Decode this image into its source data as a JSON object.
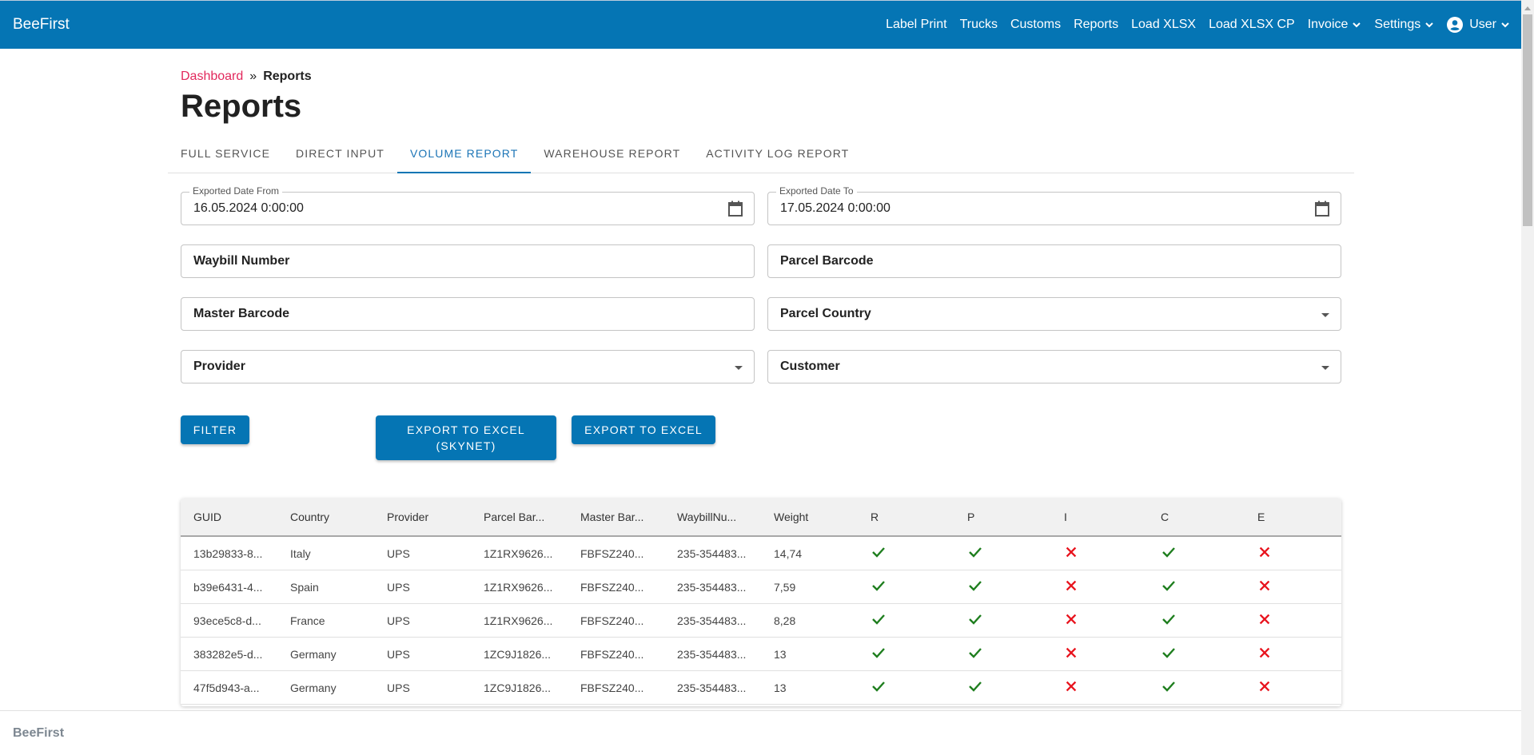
{
  "app": {
    "brand": "BeeFirst",
    "accent_color": "#0575b4"
  },
  "nav": {
    "items": [
      {
        "label": "Label Print",
        "dropdown": false
      },
      {
        "label": "Trucks",
        "dropdown": false
      },
      {
        "label": "Customs",
        "dropdown": false
      },
      {
        "label": "Reports",
        "dropdown": false
      },
      {
        "label": "Load XLSX",
        "dropdown": false
      },
      {
        "label": "Load XLSX CP",
        "dropdown": false
      },
      {
        "label": "Invoice",
        "dropdown": true
      },
      {
        "label": "Settings",
        "dropdown": true
      }
    ],
    "user_label": "User"
  },
  "breadcrumb": {
    "link": "Dashboard",
    "separator": "»",
    "current": "Reports"
  },
  "page_title": "Reports",
  "tabs": [
    {
      "label": "FULL SERVICE",
      "active": false
    },
    {
      "label": "DIRECT INPUT",
      "active": false
    },
    {
      "label": "VOLUME REPORT",
      "active": true
    },
    {
      "label": "WAREHOUSE REPORT",
      "active": false
    },
    {
      "label": "ACTIVITY LOG REPORT",
      "active": false
    }
  ],
  "filters": {
    "date_from": {
      "label": "Exported Date From",
      "value": "16.05.2024 0:00:00"
    },
    "date_to": {
      "label": "Exported Date To",
      "value": "17.05.2024 0:00:00"
    },
    "waybill_number": {
      "placeholder": "Waybill Number"
    },
    "parcel_barcode": {
      "placeholder": "Parcel Barcode"
    },
    "master_barcode": {
      "placeholder": "Master Barcode"
    },
    "parcel_country": {
      "placeholder": "Parcel Country"
    },
    "provider": {
      "placeholder": "Provider"
    },
    "customer": {
      "placeholder": "Customer"
    }
  },
  "buttons": {
    "filter": "FILTER",
    "export_skynet_line1": "EXPORT TO EXCEL",
    "export_skynet_line2": "(SKYNET)",
    "export": "EXPORT TO EXCEL"
  },
  "table": {
    "columns": [
      "GUID",
      "Country",
      "Provider",
      "Parcel Bar...",
      "Master Bar...",
      "WaybillNu...",
      "Weight",
      "R",
      "P",
      "I",
      "C",
      "E"
    ],
    "rows": [
      {
        "guid": "13b29833-8...",
        "country": "Italy",
        "provider": "UPS",
        "parcel": "1Z1RX9626...",
        "master": "FBFSZ240...",
        "waybill": "235-354483...",
        "weight": "14,74",
        "R": true,
        "P": true,
        "I": false,
        "C": true,
        "E": false
      },
      {
        "guid": "b39e6431-4...",
        "country": "Spain",
        "provider": "UPS",
        "parcel": "1Z1RX9626...",
        "master": "FBFSZ240...",
        "waybill": "235-354483...",
        "weight": "7,59",
        "R": true,
        "P": true,
        "I": false,
        "C": true,
        "E": false
      },
      {
        "guid": "93ece5c8-d...",
        "country": "France",
        "provider": "UPS",
        "parcel": "1Z1RX9626...",
        "master": "FBFSZ240...",
        "waybill": "235-354483...",
        "weight": "8,28",
        "R": true,
        "P": true,
        "I": false,
        "C": true,
        "E": false
      },
      {
        "guid": "383282e5-d...",
        "country": "Germany",
        "provider": "UPS",
        "parcel": "1ZC9J1826...",
        "master": "FBFSZ240...",
        "waybill": "235-354483...",
        "weight": "13",
        "R": true,
        "P": true,
        "I": false,
        "C": true,
        "E": false
      },
      {
        "guid": "47f5d943-a...",
        "country": "Germany",
        "provider": "UPS",
        "parcel": "1ZC9J1826...",
        "master": "FBFSZ240...",
        "waybill": "235-354483...",
        "weight": "13",
        "R": true,
        "P": true,
        "I": false,
        "C": true,
        "E": false
      }
    ],
    "status_colors": {
      "yes": "#1e7e1e",
      "no": "#e8141e"
    }
  },
  "footer": {
    "brand": "BeeFirst"
  }
}
